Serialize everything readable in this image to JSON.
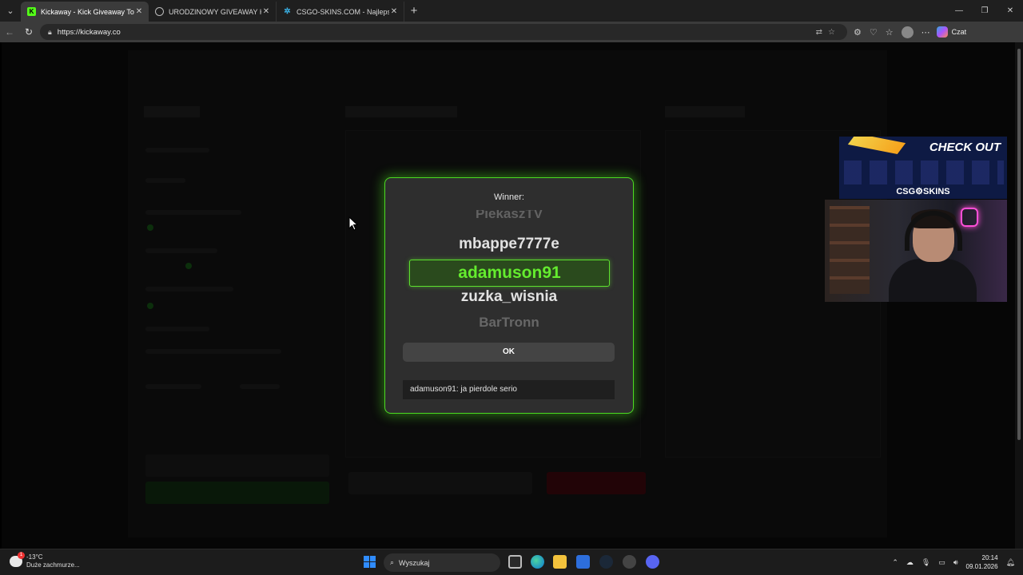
{
  "browser": {
    "tabs": [
      {
        "title": "Kickaway - Kick Giveaway Tool",
        "active": true,
        "favicon_color": "#53fc18"
      },
      {
        "title": "URODZINOWY GIVEAWAY KAMIL",
        "active": false,
        "favicon_color": "#888888"
      },
      {
        "title": "CSGO-SKINS.COM - Najlepsze Sk",
        "active": false,
        "favicon_color": "#3ab3e8"
      }
    ],
    "url": "https://kickaway.co",
    "copilot_label": "Czat"
  },
  "modal": {
    "title": "Winner:",
    "names": [
      "PiekaszTV",
      "mbappe7777e",
      "adamuson91",
      "zuzka_wisnia",
      "BarTronn"
    ],
    "winner": "adamuson91",
    "ok_label": "OK",
    "chat_message": "adamuson91: ja pierdole serio",
    "accent_color": "#4cdb22"
  },
  "overlay": {
    "ad_headline": "CHECK OUT",
    "ad_brand": "CSG⚙SKINS"
  },
  "taskbar": {
    "temperature": "-13°C",
    "weather_desc": "Duże zachmurze...",
    "weather_badge": "1",
    "search_placeholder": "Wyszukaj",
    "time": "20:14",
    "date": "09.01.2026"
  }
}
